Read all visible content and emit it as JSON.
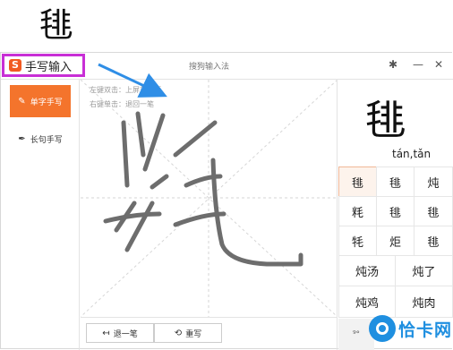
{
  "example_char": "毴",
  "window": {
    "brand_label": "手写输入",
    "title": "搜狗输入法",
    "buttons": {
      "settings": "✱",
      "minimize": "—",
      "close": "✕"
    }
  },
  "modes": [
    {
      "label": "单字手写",
      "active": true
    },
    {
      "label": "长句手写",
      "active": false
    }
  ],
  "canvas": {
    "hint_lines": [
      "左键双击：上屏首选项",
      "右键单击：退回一笔"
    ]
  },
  "actions": {
    "undo_label": "退一笔",
    "rewrite_label": "重写"
  },
  "results": {
    "preview_char": "毴",
    "pinyin": "tán,tǎn",
    "single_candidates": [
      "毴",
      "毴",
      "炖",
      "粍",
      "毴",
      "毴",
      "牦",
      "炬",
      "毴"
    ],
    "phrase_candidates": [
      "炖汤",
      "炖了",
      "炖鸡",
      "炖肉"
    ],
    "more_label": "⁹°"
  },
  "watermark": {
    "text": "恰卡网"
  },
  "colors": {
    "accent": "#f4742c",
    "highlight_border": "#c82fd6",
    "arrow": "#2f8ee6",
    "watermark": "#1f8fe0"
  }
}
